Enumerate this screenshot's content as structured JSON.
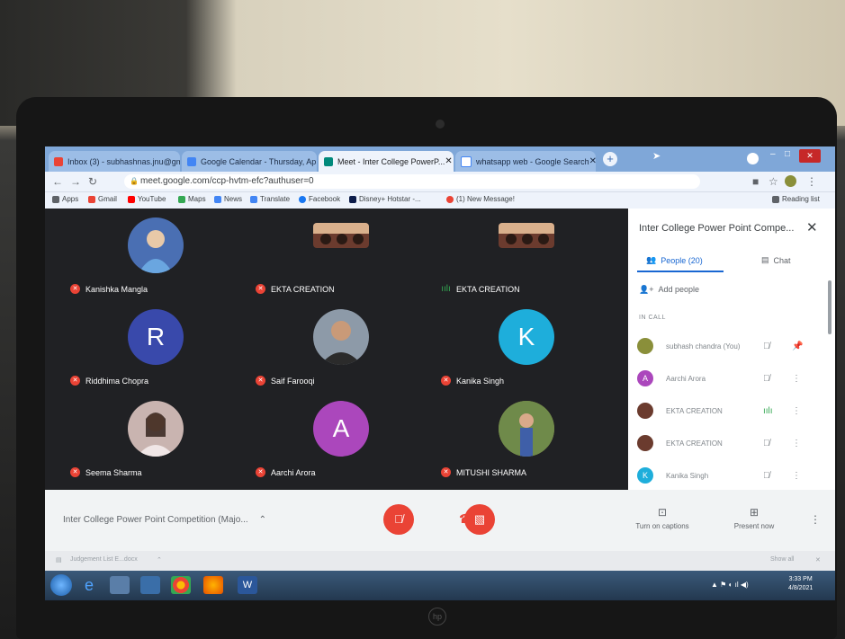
{
  "browser": {
    "tabs": [
      {
        "label": "Inbox (3) - subhashnas.jnu@gm...",
        "active": false,
        "icon_color": "#ea4335"
      },
      {
        "label": "Google Calendar - Thursday, Ap...",
        "active": false,
        "icon_color": "#4285f4"
      },
      {
        "label": "Meet - Inter College PowerP...",
        "active": true,
        "icon_color": "#00897b"
      },
      {
        "label": "whatsapp web - Google Search",
        "active": false,
        "icon_color": "#4285f4"
      }
    ],
    "new_tab": "+",
    "url": "meet.google.com/ccp-hvtm-efc?authuser=0",
    "bookmarks": [
      "Apps",
      "Gmail",
      "YouTube",
      "Maps",
      "News",
      "Translate",
      "Facebook",
      "Disney+ Hotstar -...",
      "(1) New Message!"
    ],
    "reading_list": "Reading list"
  },
  "meet": {
    "participants_grid": [
      {
        "name": "Kanishka Mangla",
        "avatar": "photo",
        "muted": true,
        "color": "#4a6fb3"
      },
      {
        "name": "EKTA CREATION",
        "avatar": "video",
        "muted": true,
        "color": "#6b3b2e"
      },
      {
        "name": "EKTA CREATION",
        "avatar": "video",
        "muted": false,
        "color": "#6b3b2e"
      },
      {
        "name": "Riddhima Chopra",
        "avatar": "R",
        "muted": true,
        "color": "#3949ab"
      },
      {
        "name": "Saif Farooqi",
        "avatar": "photo",
        "muted": true,
        "color": "#8d9aa8"
      },
      {
        "name": "Kanika Singh",
        "avatar": "K",
        "muted": true,
        "color": "#1eaedb"
      },
      {
        "name": "Seema Sharma",
        "avatar": "photo",
        "muted": true,
        "color": "#c9b4b0"
      },
      {
        "name": "Aarchi Arora",
        "avatar": "A",
        "muted": true,
        "color": "#ab47bc"
      },
      {
        "name": "MITUSHI SHARMA",
        "avatar": "photo",
        "muted": true,
        "color": "#8a7a3a"
      }
    ],
    "meeting_title": "Inter College Power Point Competition (Majo...",
    "turn_on_captions": "Turn on captions",
    "present_now": "Present now"
  },
  "panel": {
    "title": "Inter College Power Point Compe...",
    "people_tab": "People (20)",
    "chat_tab": "Chat",
    "add_people": "Add people",
    "in_call_label": "IN CALL",
    "people": [
      {
        "name": "subhash chandra (You)",
        "initial": "",
        "color": "#8a8f3a"
      },
      {
        "name": "Aarchi Arora",
        "initial": "A",
        "color": "#ab47bc"
      },
      {
        "name": "EKTA CREATION",
        "initial": "",
        "color": "#6b3b2e"
      },
      {
        "name": "EKTA CREATION",
        "initial": "",
        "color": "#6b3b2e"
      },
      {
        "name": "Kanika Singh",
        "initial": "K",
        "color": "#1eaedb"
      }
    ]
  },
  "downloads": {
    "file": "Judgement List E...docx",
    "show_all": "Show all"
  },
  "taskbar": {
    "time": "3:33 PM",
    "date": "4/8/2021"
  },
  "colors": {
    "red": "#ea4335",
    "blue": "#1967d2",
    "meet_bg": "#202124"
  }
}
